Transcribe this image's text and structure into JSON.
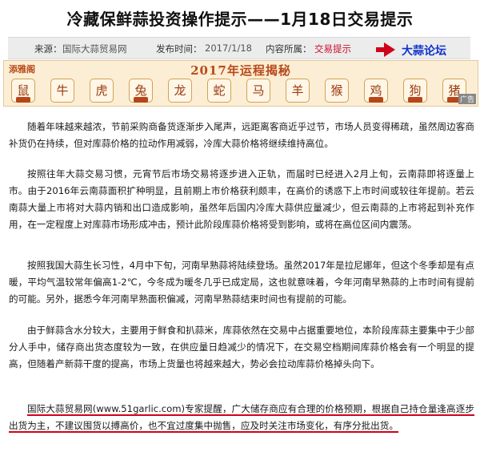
{
  "article": {
    "title": "冷藏保鲜蒜投资操作提示——1月18日交易提示"
  },
  "meta": {
    "source_label": "来源：",
    "source_value": "国际大蒜贸易网",
    "publish_label": "发布时间：",
    "publish_value": "2017/1/18",
    "category_label": "内容所属：",
    "category_value": "交易提示",
    "forum_link": "大蒜论坛"
  },
  "banner": {
    "logo_text": "添雅阁",
    "title": "2017年运程揭秘",
    "zodiac": [
      "鼠",
      "牛",
      "虎",
      "兔",
      "龙",
      "蛇",
      "马",
      "羊",
      "猴",
      "鸡",
      "狗",
      "猪"
    ],
    "ad_label": "广告"
  },
  "paragraphs": [
    "随着年味越来越浓，节前采购商备货逐渐步入尾声，远距离客商近乎过节，市场人员变得稀疏，虽然周边客商补货仍在持续，但对库蒜价格的拉动作用减弱，冷库大蒜价格将继续维持高位。",
    "按照往年大蒜交易习惯，元宵节后市场交易将逐步进入正轨，而届时已经进入2月上旬，云南蒜即将逐量上市。由于2016年云南蒜面积扩种明显，且前期上市价格获利颇丰，在高价的诱惑下上市时间或较往年提前。若云南蒜大量上市将对大蒜内销和出口造成影响，虽然年后国内冷库大蒜供应量减少，但云南蒜的上市将起到补充作用，在一定程度上对库蒜市场形成冲击，预计此阶段库蒜价格将受到影响，或将在高位区间内震荡。",
    "按照我国大蒜生长习性，4月中下旬，河南早熟蒜将陆续登场。虽然2017年是拉尼娜年，但这个冬季却是有点暖，平均气温较常年偏高1-2℃，今冬成为暖冬几乎已成定局，这也就意味着，今年河南早熟蒜的上市时间有提前的可能。另外，据悉今年河南早熟面积偏减，河南早熟蒜结束时间也有提前的可能。",
    "由于鲜蒜含水分较大，主要用于鲜食和扒蒜米，库蒜依然在交易中占据重要地位，本阶段库蒜主要集中于少部分人手中，储存商出货态度较为一致，在供应量日趋减少的情况下，在交易空档期间库蒜价格会有一个明显的提高，但随着产新蒜干度的提高，市场上货量也将越来越大，势必会拉动库蒜价格掉头向下。",
    "国际大蒜贸易网(www.51garlic.com)专家提醒，广大储存商应有合理的价格预期，根据自己持仓量逢高逐步出货为主，不建议囤货以搏高价，也不宜过度集中抛售，应及时关注市场变化，有序分批出货。"
  ]
}
